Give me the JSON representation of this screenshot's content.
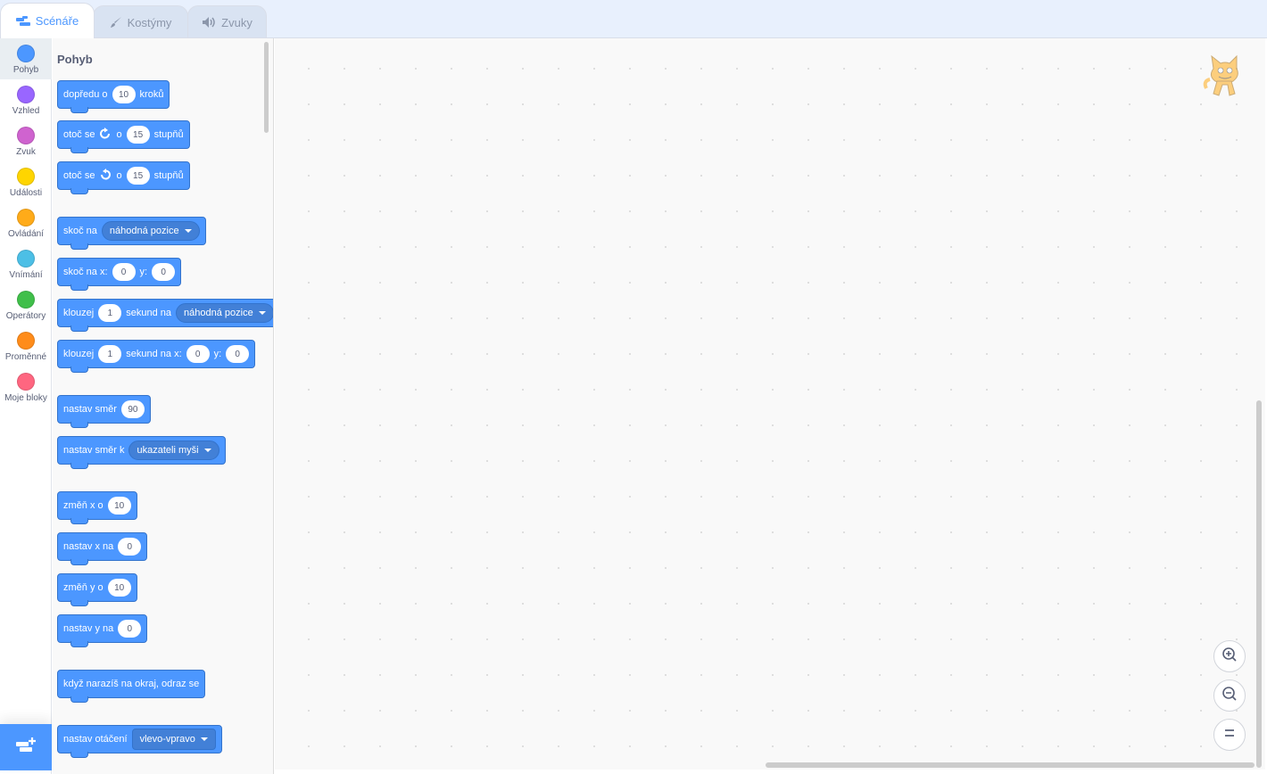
{
  "tabs": [
    {
      "label": "Scénáře",
      "icon": "code-icon",
      "active": true
    },
    {
      "label": "Kostýmy",
      "icon": "paintbrush-icon",
      "active": false
    },
    {
      "label": "Zvuky",
      "icon": "speaker-icon",
      "active": false
    }
  ],
  "categories": [
    {
      "label": "Pohyb",
      "color": "#4c97ff",
      "selected": true
    },
    {
      "label": "Vzhled",
      "color": "#9966ff"
    },
    {
      "label": "Zvuk",
      "color": "#cf63cf"
    },
    {
      "label": "Události",
      "color": "#ffd500"
    },
    {
      "label": "Ovládání",
      "color": "#ffab19"
    },
    {
      "label": "Vnímání",
      "color": "#4cbfe6"
    },
    {
      "label": "Operátory",
      "color": "#40bf4a"
    },
    {
      "label": "Proměnné",
      "color": "#ff8c1a"
    },
    {
      "label": "Moje bloky",
      "color": "#ff6680"
    }
  ],
  "extension_button": {
    "icon": "add-extension-icon"
  },
  "flyout": {
    "title": "Pohyb",
    "blocks": {
      "move": {
        "t1": "dopředu o",
        "v1": "10",
        "t2": "kroků"
      },
      "turn_right": {
        "t1": "otoč se",
        "t2": "o",
        "v1": "15",
        "t3": "stupňů"
      },
      "turn_left": {
        "t1": "otoč se",
        "t2": "o",
        "v1": "15",
        "t3": "stupňů"
      },
      "goto": {
        "t1": "skoč na",
        "d1": "náhodná pozice"
      },
      "goto_xy": {
        "t1": "skoč na x:",
        "v1": "0",
        "t2": "y:",
        "v2": "0"
      },
      "glide": {
        "t1": "klouzej",
        "v1": "1",
        "t2": "sekund na",
        "d1": "náhodná pozice"
      },
      "glide_xy": {
        "t1": "klouzej",
        "v1": "1",
        "t2": "sekund na x:",
        "v2": "0",
        "t3": "y:",
        "v3": "0"
      },
      "point_dir": {
        "t1": "nastav směr",
        "v1": "90"
      },
      "point_towards": {
        "t1": "nastav směr k",
        "d1": "ukazateli myši"
      },
      "change_x": {
        "t1": "změň x o",
        "v1": "10"
      },
      "set_x": {
        "t1": "nastav x na",
        "v1": "0"
      },
      "change_y": {
        "t1": "změň y o",
        "v1": "10"
      },
      "set_y": {
        "t1": "nastav y na",
        "v1": "0"
      },
      "bounce": {
        "t1": "když narazíš na okraj, odraz se"
      },
      "rotation": {
        "t1": "nastav otáčení",
        "d1": "vlevo-vpravo"
      }
    }
  },
  "workspace": {
    "sprite_icon": "cat-sprite-icon",
    "zoom_buttons": [
      "zoom-in-icon",
      "zoom-out-icon",
      "zoom-reset-icon"
    ]
  }
}
